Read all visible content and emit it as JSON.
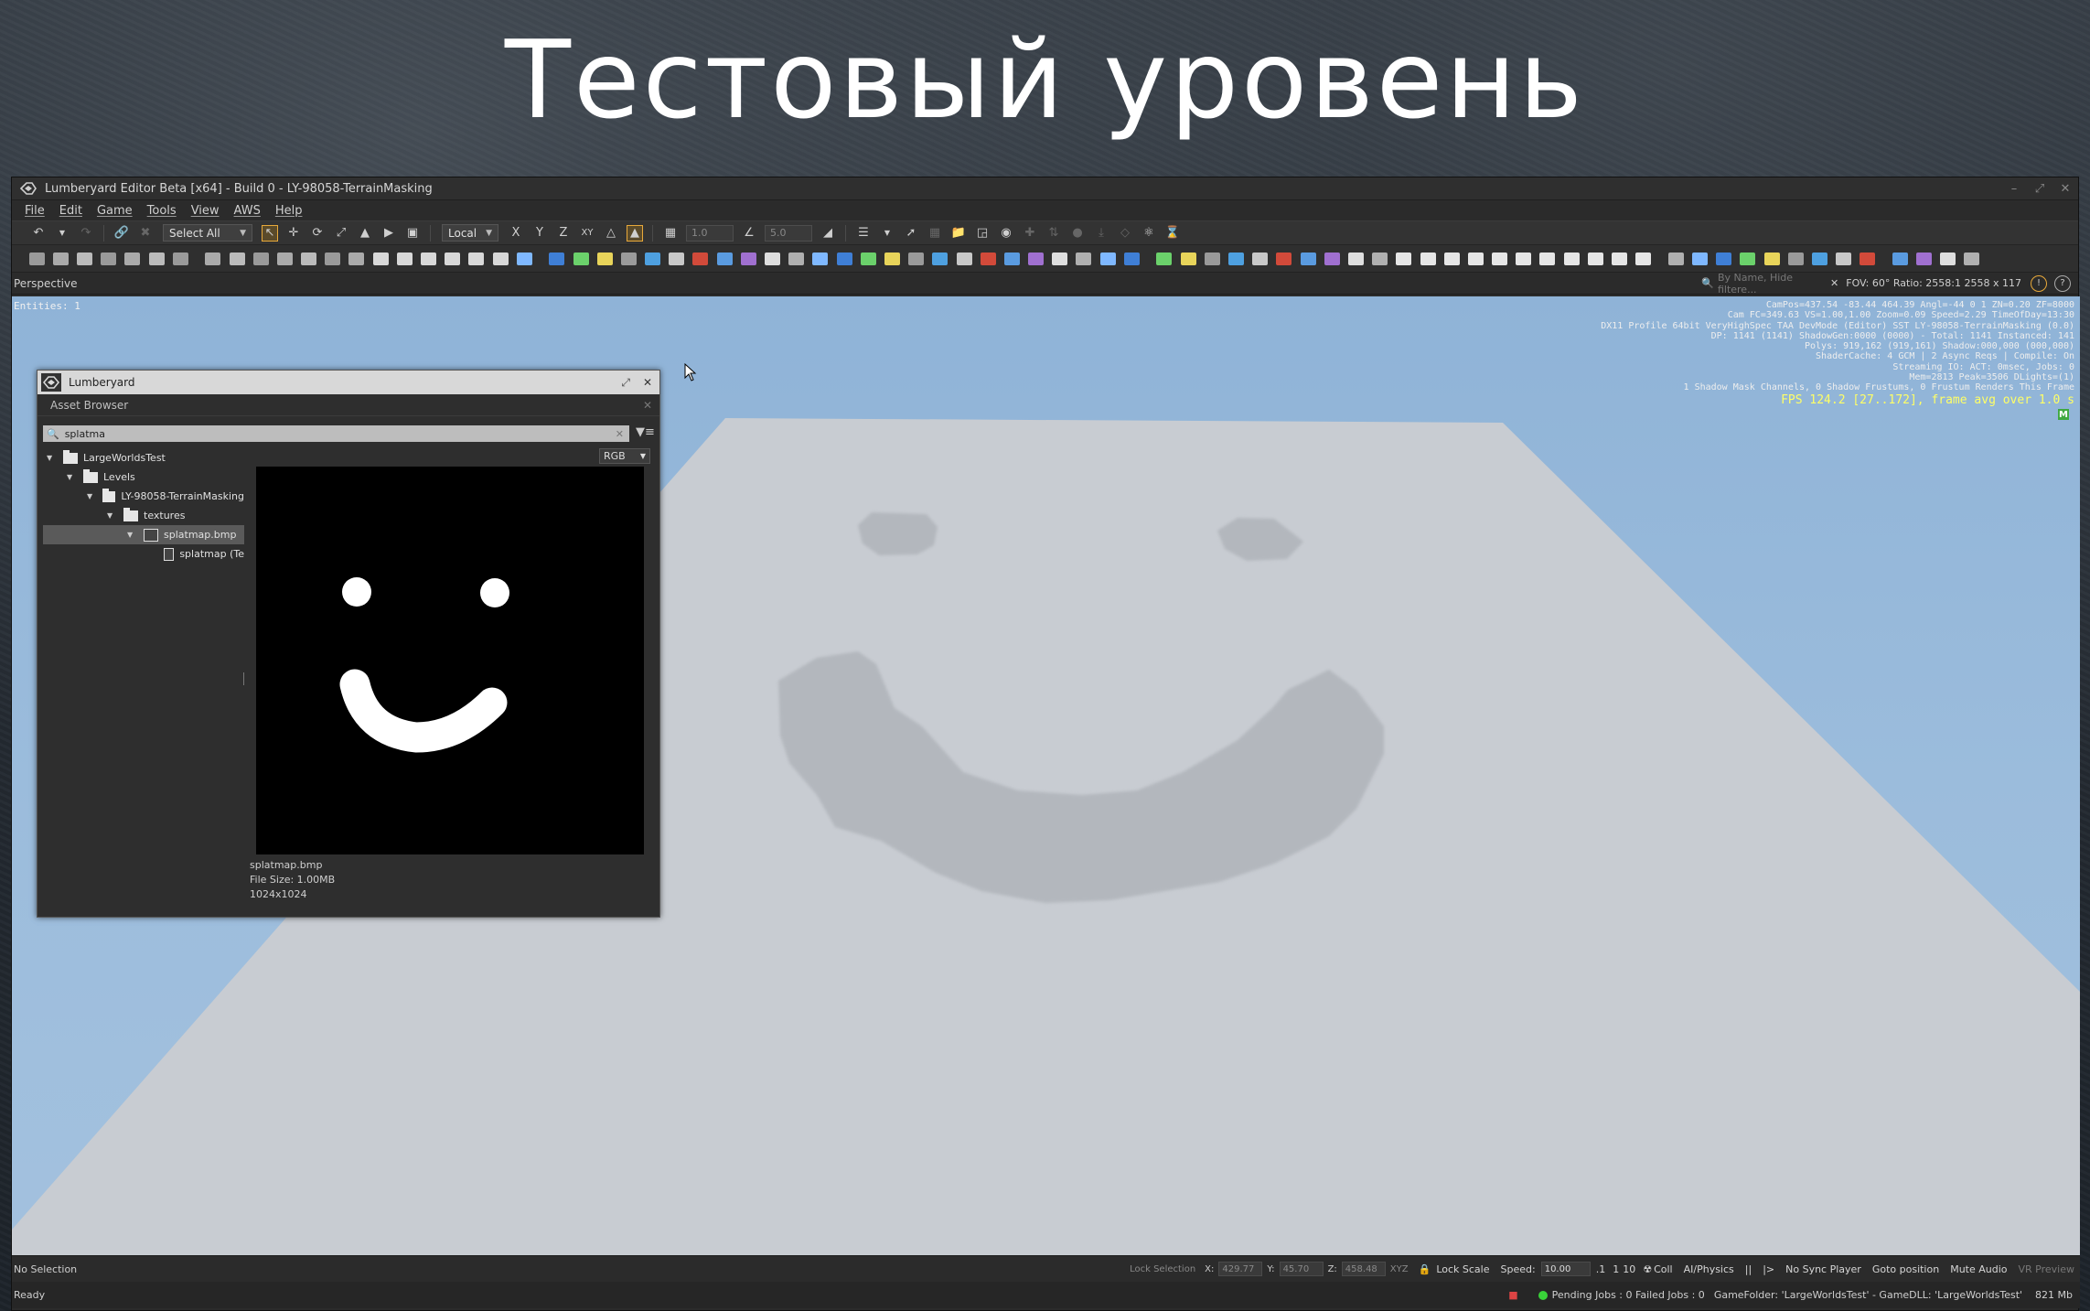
{
  "slide": {
    "title": "Тестовый уровень"
  },
  "window": {
    "title": "Lumberyard Editor Beta [x64] - Build 0 - LY-98058-TerrainMasking",
    "controls": [
      "minimize-icon",
      "maximize-icon",
      "close-icon"
    ]
  },
  "menu": {
    "items": [
      "File",
      "Edit",
      "Game",
      "Tools",
      "View",
      "AWS",
      "Help"
    ]
  },
  "toolbar": {
    "select_all": "Select All",
    "coord_space": "Local",
    "axes": [
      "X",
      "Y",
      "Z",
      "XY"
    ],
    "grid_value": "1.0",
    "angle_value": "5.0"
  },
  "viewport": {
    "label": "Perspective",
    "search_placeholder": "By Name, Hide filtere...",
    "fov_info": "FOV: 60°  Ratio: 2558:1  2558 x 117",
    "entities": "Entities: 1",
    "debug_lines": [
      "CamPos=437.54 -83.44 464.39 Angl=-44  0   1 ZN=0.20 ZF=8000",
      "Cam FC=349.63 VS=1.00,1.00 Zoom=0.09 Speed=2.29 TimeOfDay=13:30",
      "DX11 Profile 64bit VeryHighSpec TAA DevMode (Editor) SST LY-98058-TerrainMasking (0.0)",
      "DP: 1141 (1141) ShadowGen:0000 (0000) - Total: 1141 Instanced: 141",
      "Polys: 919,162 (919,161) Shadow:000,000 (000,000)",
      "ShaderCache: 4 GCM | 2 Async Reqs | Compile: On",
      "Streaming IO: ACT:   0msec, Jobs: 0",
      "Mem=2813 Peak=3506 DLights=(1)",
      "1 Shadow Mask Channels,   0 Shadow Frustums,   0 Frustum Renders This Frame"
    ],
    "fps": "FPS 124.2 [27..172], frame avg over 1.0 s",
    "badge": "M"
  },
  "asset_browser": {
    "window_title": "Lumberyard",
    "panel_title": "Asset Browser",
    "search_value": "splatma",
    "channel": "RGB",
    "tree": [
      {
        "label": "LargeWorldsTest",
        "level": 0,
        "type": "folder",
        "expanded": true
      },
      {
        "label": "Levels",
        "level": 1,
        "type": "folder",
        "expanded": true
      },
      {
        "label": "LY-98058-TerrainMasking",
        "level": 2,
        "type": "folder",
        "expanded": true
      },
      {
        "label": "textures",
        "level": 3,
        "type": "folder",
        "expanded": true
      },
      {
        "label": "splatmap.bmp",
        "level": 4,
        "type": "image",
        "expanded": true,
        "selected": true
      },
      {
        "label": "splatmap (Te",
        "level": 5,
        "type": "image",
        "expanded": false
      }
    ],
    "info": {
      "filename": "splatmap.bmp",
      "filesize": "File Size: 1.00MB",
      "dimensions": "1024x1024"
    }
  },
  "status_top": {
    "selection": "No Selection",
    "lock_selection": "Lock Selection",
    "x_label": "X:",
    "x_value": "429.77",
    "y_label": "Y:",
    "y_value": "45.70",
    "z_label": "Z:",
    "z_value": "458.48",
    "xyz": "XYZ",
    "lock_scale": "Lock Scale",
    "speed_label": "Speed:",
    "speed_value": "10.00",
    "speed_presets": [
      ".1",
      "1",
      "10"
    ],
    "coll": "Coll",
    "ai_physics": "AI/Physics",
    "pause": "||",
    "step": "|>",
    "no_sync": "No Sync Player",
    "goto": "Goto position",
    "mute": "Mute Audio",
    "vr": "VR Preview"
  },
  "status_bottom": {
    "ready": "Ready",
    "jobs": "Pending Jobs : 0  Failed Jobs : 0",
    "gamefolder": "GameFolder: 'LargeWorldsTest' - GameDLL: 'LargeWorldsTest'",
    "memory": "821 Mb"
  },
  "colors": {
    "sky": "#9bbcdc",
    "terrain": "#c9cdd2",
    "terrain_mask": "#b4b8be",
    "accent": "#e8a93a"
  }
}
